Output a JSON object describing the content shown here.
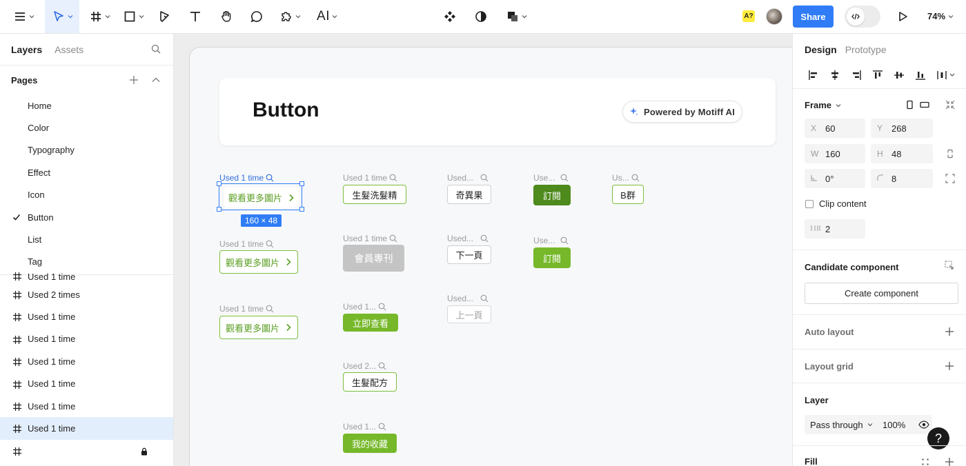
{
  "toolbar": {
    "ai_label": "AI",
    "badge_label": "A?",
    "share_label": "Share",
    "zoom": "74%"
  },
  "left_panel": {
    "tabs": [
      "Layers",
      "Assets"
    ],
    "pages_title": "Pages",
    "pages": [
      "Home",
      "Color",
      "Typography",
      "Effect",
      "Icon",
      "Button",
      "List",
      "Tag"
    ],
    "selected_page": "Button",
    "layers": [
      "Used 1 time",
      "Used 2 times",
      "Used 1 time",
      "Used 1 time",
      "Used 1 time",
      "Used 1 time",
      "Used 1 time",
      "Used 1 time"
    ]
  },
  "canvas": {
    "title": "Button",
    "motiff_label": "Powered by Motiff AI",
    "selection_size": "160 × 48",
    "used_labels": {
      "c1": [
        "Used 1 time",
        "Used 1 time",
        "Used 1 time"
      ],
      "c2": [
        "Used 1 time",
        "Used 1 time",
        "Used 1...",
        "Used 2...",
        "Used 1..."
      ],
      "c3": [
        "Used...",
        "Used...",
        "Used..."
      ],
      "c4": [
        "Use...",
        "Use..."
      ],
      "c5": [
        "Us..."
      ]
    },
    "buttons": {
      "c1": [
        "觀看更多圖片",
        "觀看更多圖片",
        "觀看更多圖片"
      ],
      "c2": [
        "生髮洗髮精",
        "會員專刊",
        "立即查看",
        "生髮配方",
        "我的收藏"
      ],
      "c3": [
        "奇異果",
        "下一頁",
        "上一頁"
      ],
      "c4": [
        "訂閱",
        "訂閱"
      ],
      "c5": [
        "B群"
      ]
    }
  },
  "right_panel": {
    "tabs": [
      "Design",
      "Prototype"
    ],
    "frame_title": "Frame",
    "x": "60",
    "y": "268",
    "w": "160",
    "h": "48",
    "rotation": "0°",
    "radius": "8",
    "clip_label": "Clip content",
    "spacing": "2",
    "candidate_title": "Candidate component",
    "create_label": "Create component",
    "auto_layout": "Auto layout",
    "layout_grid": "Layout grid",
    "layer_title": "Layer",
    "blend_mode": "Pass through",
    "opacity": "100%",
    "fill_title": "Fill",
    "help": "?"
  },
  "colors": {
    "accent": "#2f7cf6",
    "green": "#76b82a",
    "dark_green": "#4e8a1c"
  }
}
